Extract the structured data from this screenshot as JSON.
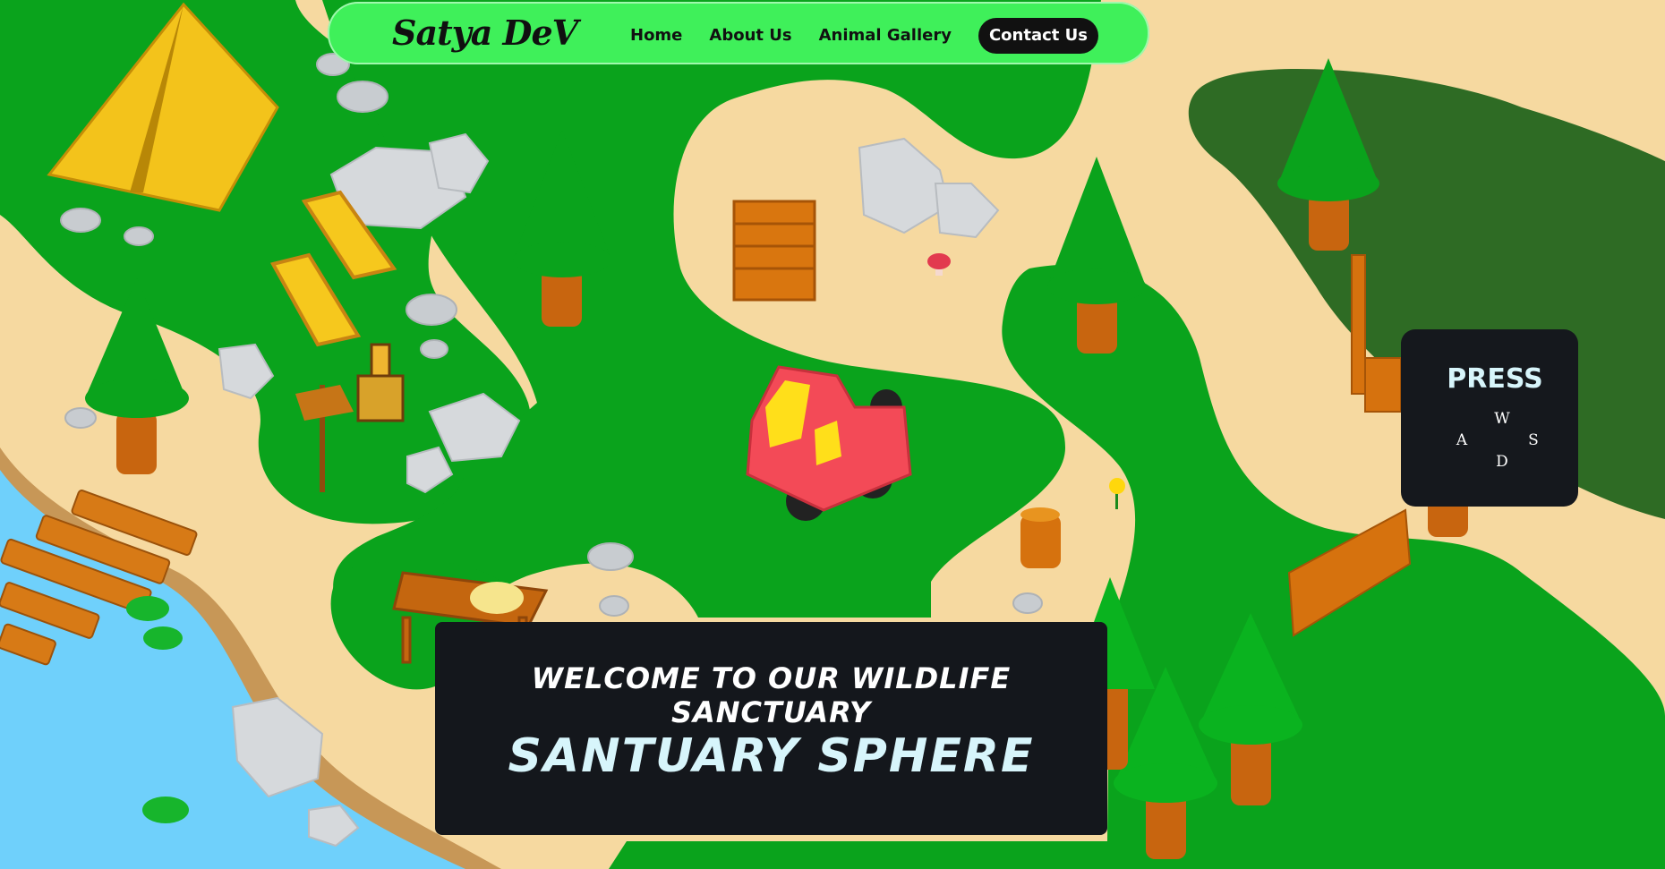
{
  "nav": {
    "brand": "Satya DeV",
    "links": [
      "Home",
      "About Us",
      "Animal Gallery"
    ],
    "contact_label": "Contact Us"
  },
  "controls": {
    "title": "PRESS",
    "keys": {
      "up": "W",
      "left": "A",
      "right": "S",
      "down": "D"
    }
  },
  "hero": {
    "subtitle": "WELCOME TO OUR WILDLIFE SANCTUARY",
    "title": "SANTUARY SPHERE"
  },
  "colors": {
    "sand": "#f6d9a0",
    "grass": "#0aa31c",
    "grass_dark": "#2c6a23",
    "water": "#6fd0fb",
    "nav_green": "#3ff05a",
    "panel_dark": "#15181d",
    "title_cyan": "#d7f5fb"
  }
}
